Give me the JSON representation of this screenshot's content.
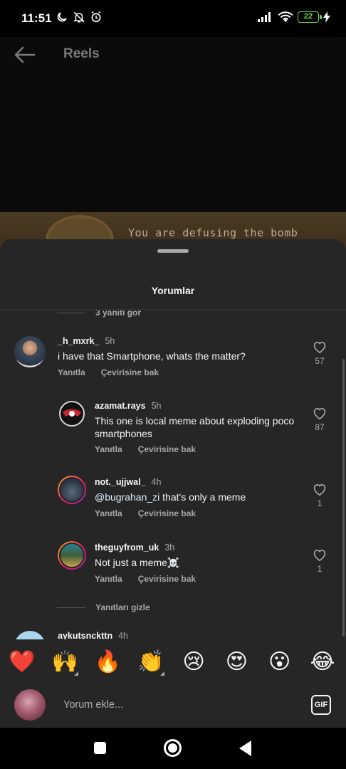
{
  "status_bar": {
    "time": "11:51",
    "battery": "22",
    "icons": [
      "moon-icon",
      "bell-off-icon",
      "alarm-icon",
      "signal-icon",
      "wifi-icon",
      "battery-icon",
      "charging-icon"
    ]
  },
  "reel": {
    "title": "Reels",
    "video_caption": "You are defusing the bomb"
  },
  "sheet": {
    "title": "Yorumlar",
    "view_replies_top": "3 yanıtı gör",
    "hide_replies": "Yanıtları gizle",
    "comments": [
      {
        "username": "_h_mxrk_",
        "time": "5h",
        "text": "i have that Smartphone, whats the matter?",
        "reply_label": "Yanıtla",
        "translate_label": "Çevirisine bak",
        "likes": "57"
      },
      {
        "username": "azamat.rays",
        "time": "5h",
        "text": "This one is local meme about exploding poco smartphones",
        "reply_label": "Yanıtla",
        "translate_label": "Çevirisine bak",
        "likes": "87"
      },
      {
        "username": "not._ujjwal_",
        "time": "4h",
        "mention": "@bugrahan_zi",
        "text": " that's only a meme",
        "reply_label": "Yanıtla",
        "translate_label": "Çevirisine bak",
        "likes": "1"
      },
      {
        "username": "theguyfrom_uk",
        "time": "3h",
        "text": "Not just a meme☠️",
        "reply_label": "Yanıtla",
        "translate_label": "Çevirisine bak",
        "likes": "1"
      },
      {
        "username": "aykutsnckttn",
        "time": "4h"
      }
    ]
  },
  "emoji_bar": [
    "❤️",
    "🙌",
    "🔥",
    "👏",
    "😢",
    "😍",
    "😮",
    "😂"
  ],
  "input": {
    "placeholder": "Yorum ekle...",
    "gif_label": "GIF"
  },
  "colors": {
    "sheet_bg": "#262626",
    "text_primary": "#f5f5f5",
    "text_secondary": "#a8a8a8",
    "battery_green": "#6cd64a"
  }
}
